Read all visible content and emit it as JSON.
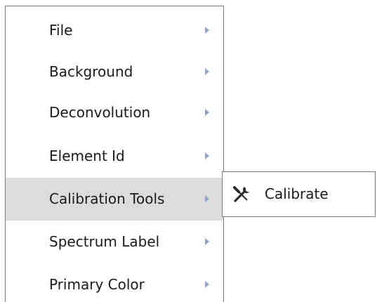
{
  "context_menu": {
    "items": [
      {
        "label": "File",
        "has_submenu": true,
        "highlighted": false
      },
      {
        "label": "Background",
        "has_submenu": true,
        "highlighted": false
      },
      {
        "label": "Deconvolution",
        "has_submenu": true,
        "highlighted": false
      },
      {
        "label": "Element Id",
        "has_submenu": true,
        "highlighted": false
      },
      {
        "label": "Calibration Tools",
        "has_submenu": true,
        "highlighted": true
      },
      {
        "label": "Spectrum Label",
        "has_submenu": true,
        "highlighted": false
      },
      {
        "label": "Primary Color",
        "has_submenu": true,
        "highlighted": false
      }
    ]
  },
  "submenu": {
    "items": [
      {
        "label": "Calibrate",
        "icon": "tools-icon"
      }
    ]
  },
  "colors": {
    "highlight_background": "#dcdcdc",
    "arrow": "#90a6c8",
    "border": "#7a7a7a",
    "text": "#1a1a1a"
  }
}
